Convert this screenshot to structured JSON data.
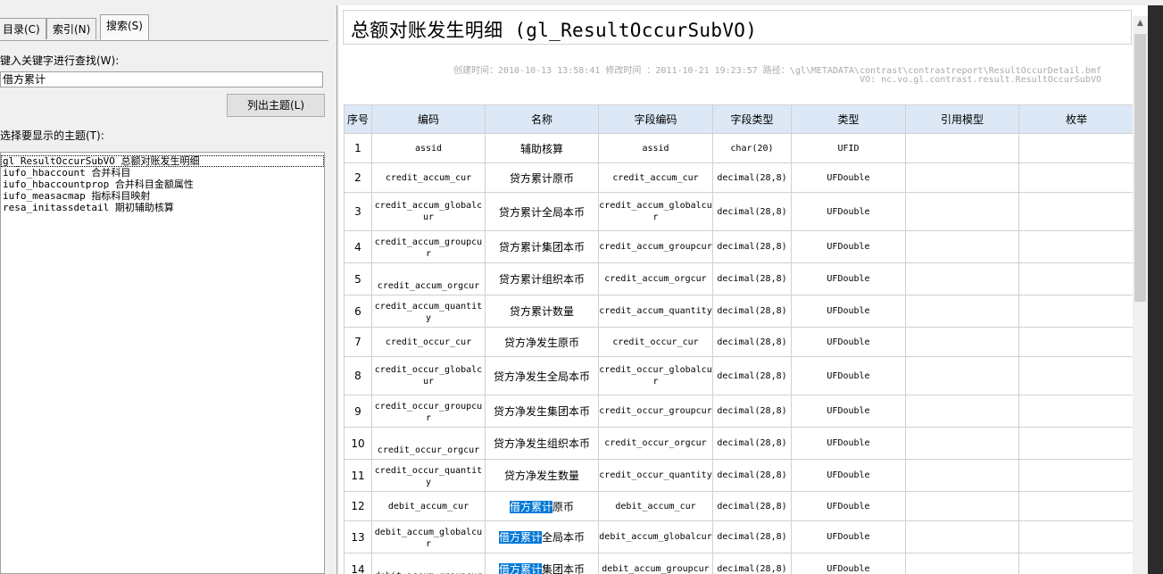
{
  "tabs": [
    {
      "label": "目录(C)"
    },
    {
      "label": "索引(N)"
    },
    {
      "label": "搜索(S)"
    }
  ],
  "search": {
    "keyword_label": "键入关键字进行查找(W):",
    "keyword_value": "借方累计",
    "list_button": "列出主题(L)",
    "topics_label": "选择要显示的主题(T):"
  },
  "topics": [
    "gl_ResultOccurSubVO 总额对账发生明细",
    "iufo_hbaccount 合并科目",
    "iufo_hbaccountprop 合并科目金额属性",
    "iufo_measacmap 指标科目映射",
    "resa_initassdetail 期初辅助核算"
  ],
  "doc": {
    "title": "总额对账发生明细 (gl_ResultOccurSubVO)",
    "meta_line1": "创建时间：2010-10-13 13:58:41  修改时间 ：2011-10-21 19:23:57  路径：\\gl\\METADATA\\contrast\\contrastreport\\ResultOccurDetail.bmf",
    "meta_line2": "VO: nc.vo.gl.contrast.result.ResultOccurSubVO"
  },
  "table": {
    "headers": [
      "序号",
      "编码",
      "名称",
      "字段编码",
      "字段类型",
      "类型",
      "引用模型",
      "枚举"
    ],
    "rows": [
      {
        "no": "1",
        "code": "assid",
        "name_hl": "",
        "name": "辅助核算",
        "field": "assid",
        "ftype": "char(20)",
        "type": "UFID"
      },
      {
        "no": "2",
        "code": "credit_accum_cur",
        "name_hl": "",
        "name": "贷方累计原币",
        "field": "credit_accum_cur",
        "ftype": "decimal(28,8)",
        "type": "UFDouble"
      },
      {
        "no": "3",
        "code": "credit_accum_globalcur",
        "name_hl": "",
        "name": "贷方累计全局本币",
        "field": "credit_accum_globalcur",
        "ftype": "decimal(28,8)",
        "type": "UFDouble"
      },
      {
        "no": "4",
        "code": "credit_accum_groupcur",
        "name_hl": "",
        "name": "贷方累计集团本币",
        "field": "credit_accum_groupcur",
        "ftype": "decimal(28,8)",
        "type": "UFDouble"
      },
      {
        "no": "5",
        "code": "credit_accum_orgcur",
        "name_hl": "",
        "name": "贷方累计组织本币",
        "field": "credit_accum_orgcur",
        "ftype": "decimal(28,8)",
        "type": "UFDouble"
      },
      {
        "no": "6",
        "code": "credit_accum_quantity",
        "name_hl": "",
        "name": "贷方累计数量",
        "field": "credit_accum_quantity",
        "ftype": "decimal(28,8)",
        "type": "UFDouble"
      },
      {
        "no": "7",
        "code": "credit_occur_cur",
        "name_hl": "",
        "name": "贷方净发生原币",
        "field": "credit_occur_cur",
        "ftype": "decimal(28,8)",
        "type": "UFDouble"
      },
      {
        "no": "8",
        "code": "credit_occur_globalcur",
        "name_hl": "",
        "name": "贷方净发生全局本币",
        "field": "credit_occur_globalcur",
        "ftype": "decimal(28,8)",
        "type": "UFDouble"
      },
      {
        "no": "9",
        "code": "credit_occur_groupcur",
        "name_hl": "",
        "name": "贷方净发生集团本币",
        "field": "credit_occur_groupcur",
        "ftype": "decimal(28,8)",
        "type": "UFDouble"
      },
      {
        "no": "10",
        "code": "credit_occur_orgcur",
        "name_hl": "",
        "name": "贷方净发生组织本币",
        "field": "credit_occur_orgcur",
        "ftype": "decimal(28,8)",
        "type": "UFDouble"
      },
      {
        "no": "11",
        "code": "credit_occur_quantity",
        "name_hl": "",
        "name": "贷方净发生数量",
        "field": "credit_occur_quantity",
        "ftype": "decimal(28,8)",
        "type": "UFDouble"
      },
      {
        "no": "12",
        "code": "debit_accum_cur",
        "name_hl": "借方累计",
        "name": "原币",
        "field": "debit_accum_cur",
        "ftype": "decimal(28,8)",
        "type": "UFDouble"
      },
      {
        "no": "13",
        "code": "debit_accum_globalcur",
        "name_hl": "借方累计",
        "name": "全局本币",
        "field": "debit_accum_globalcur",
        "ftype": "decimal(28,8)",
        "type": "UFDouble"
      },
      {
        "no": "14",
        "code": "debit_accum_groupcur",
        "name_hl": "借方累计",
        "name": "集团本币",
        "field": "debit_accum_groupcur",
        "ftype": "decimal(28,8)",
        "type": "UFDouble"
      }
    ]
  },
  "colors": {
    "header_bg": "#dce8f6",
    "highlight": "#0078d7"
  }
}
